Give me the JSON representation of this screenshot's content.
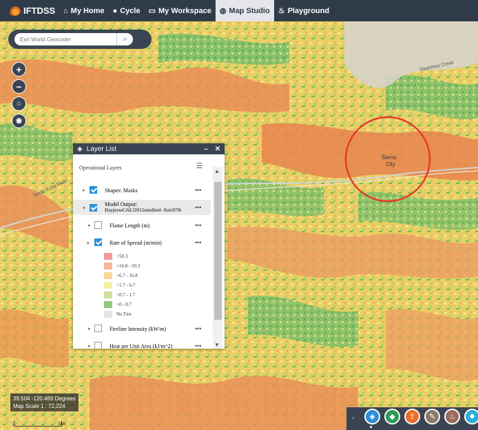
{
  "nav": {
    "logo": "IFTDSS",
    "items": [
      {
        "icon": "home-icon",
        "glyph": "⌂",
        "label": "My Home"
      },
      {
        "icon": "cycle-icon",
        "glyph": "●",
        "label": "Cycle"
      },
      {
        "icon": "workspace-icon",
        "glyph": "▭",
        "label": "My Workspace"
      },
      {
        "icon": "globe-icon",
        "glyph": "◍",
        "label": "Map Studio",
        "active": true
      },
      {
        "icon": "flame-icon",
        "glyph": "♨",
        "label": "Playground"
      }
    ]
  },
  "geocoder": {
    "placeholder": "Esri World Geocoder"
  },
  "map": {
    "labels": {
      "town": "Sierra City",
      "town_line1": "Sierra",
      "town_line2": "City",
      "river": "North Yuba River",
      "creek": "Haypress Creek"
    }
  },
  "layer_list": {
    "title": "Layer List",
    "minimize": "–",
    "close": "✕",
    "operational_layers": "Operational Layers",
    "layers": [
      {
        "label": "Shapes: Masks",
        "checked": true
      },
      {
        "label_line1": "Model Output:",
        "label_line2": "HaypressCrkLf2012unedited- Auto97th",
        "checked": true
      },
      {
        "label": "Flame Length (m)",
        "checked": false
      },
      {
        "label": "Rate of Spread (m/min)",
        "checked": true
      },
      {
        "label": "Fireline Intensity (kW/m)",
        "checked": false
      },
      {
        "label": "Heat per Unit Area (kJ/m^2)",
        "checked": false
      }
    ],
    "legend": [
      {
        "label": ">50.3",
        "color": "#f49a9a"
      },
      {
        "label": ">16.8 - 50.3",
        "color": "#f7b69a"
      },
      {
        "label": ">6.7 - 16.8",
        "color": "#f9d79a"
      },
      {
        "label": ">1.7 - 6.7",
        "color": "#f7f0a4"
      },
      {
        "label": ">0.7 - 1.7",
        "color": "#cfe29b"
      },
      {
        "label": ">0 - 0.7",
        "color": "#8fc77f"
      },
      {
        "label": "No Fire",
        "color": "#e4e4e4"
      }
    ],
    "more": "•••"
  },
  "status": {
    "coords": "39.504 -120.469 Degrees",
    "scale": "Map Scale 1 : 72,224",
    "scale_unit": "1mi"
  },
  "toolbar": {
    "buttons": [
      {
        "icon": "layers-icon",
        "color": "#2d8fd5"
      },
      {
        "icon": "basemap-icon",
        "color": "#2a9c54"
      },
      {
        "icon": "upload-icon",
        "color": "#e8702a"
      },
      {
        "icon": "measure-icon",
        "color": "#8a7a6a"
      },
      {
        "icon": "fire-icon",
        "color": "#9a6a5a"
      },
      {
        "icon": "pin-icon",
        "color": "#2ab0d8"
      }
    ]
  }
}
